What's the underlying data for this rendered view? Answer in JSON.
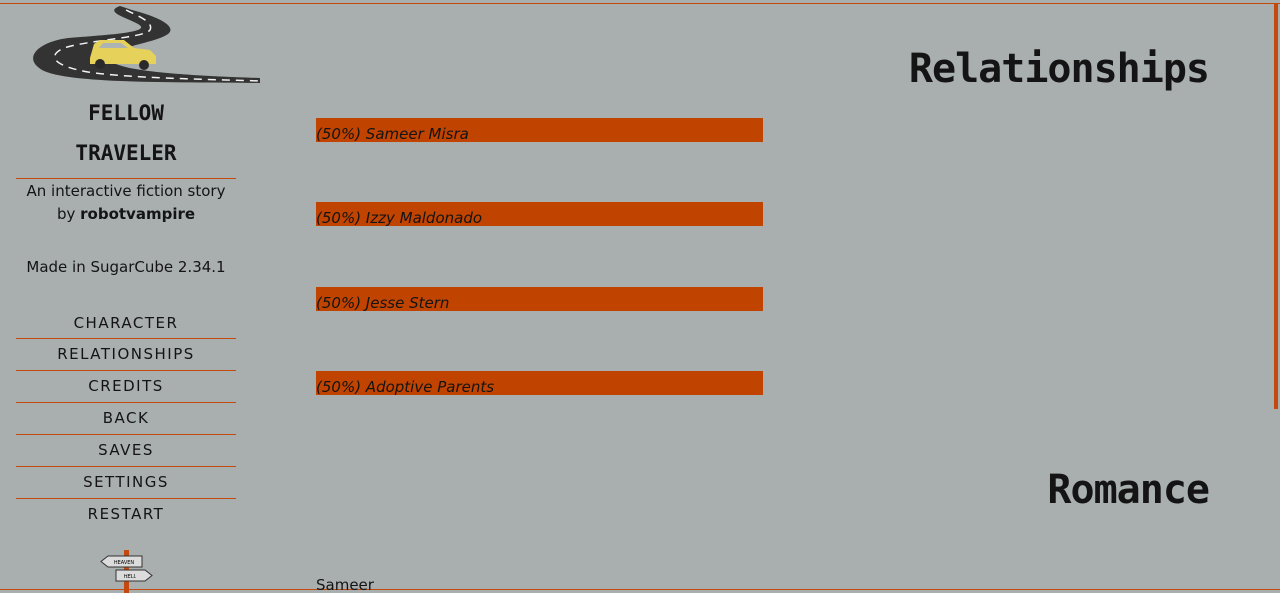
{
  "sidebar": {
    "title_line1": "FELLOW",
    "title_line2": "TRAVELER",
    "subtitle_line1": "An interactive fiction story",
    "subtitle_by": "by",
    "author": "robotvampire",
    "made_in": "Made in SugarCube 2.34.1",
    "menu": [
      "CHARACTER",
      "RELATIONSHIPS",
      "CREDITS",
      "BACK",
      "SAVES",
      "SETTINGS",
      "RESTART"
    ],
    "signpost": {
      "top_sign": "HEAVEN",
      "bottom_sign": "HELL"
    }
  },
  "main": {
    "relationships_heading": "Relationships",
    "relationships": [
      {
        "label": "(50%) Sameer Misra",
        "value": 50
      },
      {
        "label": "(50%) Izzy Maldonado",
        "value": 50
      },
      {
        "label": "(50%) Jesse Stern",
        "value": 50
      },
      {
        "label": "(50%) Adoptive Parents",
        "value": 50
      }
    ],
    "romance_heading": "Romance",
    "romance_first": "Sameer"
  },
  "colors": {
    "background": "#a9aeae",
    "accent": "#c24a0e",
    "bar": "#c14300",
    "text": "#141414",
    "car": "#e6d25a",
    "road": "#333333"
  },
  "icons": [
    "winding-road-car-icon",
    "heaven-hell-signpost-icon"
  ]
}
